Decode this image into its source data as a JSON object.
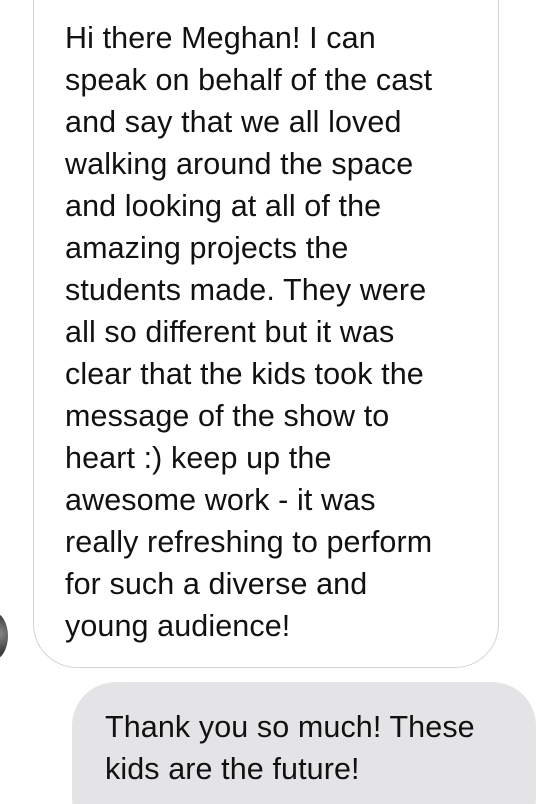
{
  "conversation": {
    "messages": [
      {
        "direction": "received",
        "text": "Hi there Meghan! I can\nspeak on behalf of the cast\nand say that we all loved\nwalking around the space\nand looking at all of the\namazing projects the\nstudents made. They were\nall so different but it was\nclear that the kids took the\nmessage of the show to\nheart :) keep up the\nawesome work - it was\nreally refreshing to perform\nfor such a diverse and\nyoung audience!"
      },
      {
        "direction": "sent",
        "text": "Thank you so much! These\nkids are the future!"
      }
    ]
  },
  "colors": {
    "received_bubble_bg": "#ffffff",
    "received_bubble_border": "#d4d4d6",
    "sent_bubble_bg": "#e4e4e6",
    "text": "#111111"
  }
}
